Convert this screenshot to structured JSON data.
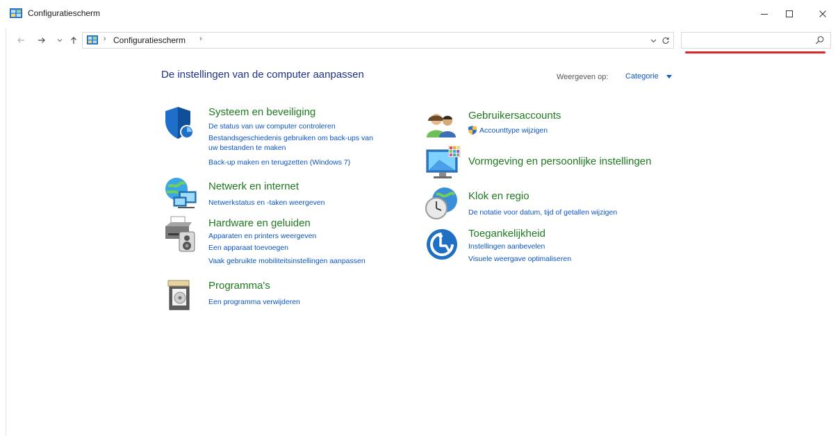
{
  "window": {
    "title": "Configuratiescherm",
    "controls": {
      "minimize": "minimize",
      "maximize": "maximize",
      "close": "close"
    }
  },
  "addressbar": {
    "breadcrumb": "Configuratiescherm",
    "separator": "›"
  },
  "search": {
    "placeholder": "",
    "value": ""
  },
  "content": {
    "heading": "De instellingen van de computer aanpassen",
    "view_label": "Weergeven op:",
    "view_value": "Categorie"
  },
  "categories": {
    "systeem": {
      "title": "Systeem en beveiliging",
      "links": [
        "De status van uw computer controleren",
        "Bestandsgeschiedenis gebruiken om back-ups van",
        "uw bestanden te maken",
        "Back-up maken en terugzetten (Windows 7)"
      ]
    },
    "netwerk": {
      "title": "Netwerk en internet",
      "links": [
        "Netwerkstatus en -taken weergeven"
      ]
    },
    "hardware": {
      "title": "Hardware en geluiden",
      "links": [
        "Apparaten en printers weergeven",
        "Een apparaat toevoegen",
        "Vaak gebruikte mobiliteitsinstellingen aanpassen"
      ]
    },
    "programmas": {
      "title": "Programma's",
      "links": [
        "Een programma verwijderen"
      ]
    },
    "gebruikers": {
      "title": "Gebruikersaccounts",
      "links": [
        "Accounttype wijzigen"
      ]
    },
    "vormgeving": {
      "title": "Vormgeving en persoonlijke instellingen",
      "links": []
    },
    "klok": {
      "title": "Klok en regio",
      "links": [
        "De notatie voor datum, tijd of getallen wijzigen"
      ]
    },
    "toegankelijkheid": {
      "title": "Toegankelijkheid",
      "links": [
        "Instellingen aanbevelen",
        "Visuele weergave optimaliseren"
      ]
    }
  },
  "colors": {
    "category_title": "#1f7a1f",
    "link": "#0b55c4",
    "heading": "#1e3287",
    "search_underline": "#e0242c"
  },
  "icons": {
    "systeem": "shield-icon",
    "netwerk": "globe-network-icon",
    "hardware": "printer-icon",
    "programmas": "programs-icon",
    "gebruikers": "users-icon",
    "vormgeving": "monitor-palette-icon",
    "klok": "clock-globe-icon",
    "toegankelijkheid": "accessibility-icon"
  }
}
